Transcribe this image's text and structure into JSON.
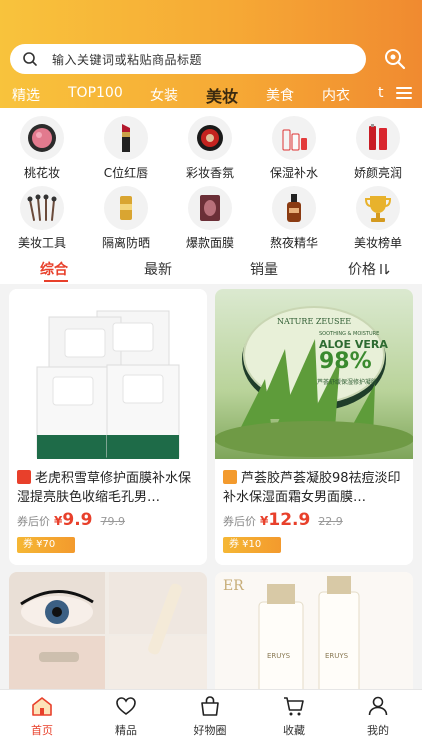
{
  "search": {
    "placeholder": "输入关键词或粘贴商品标题"
  },
  "tabs": [
    {
      "label": "精选"
    },
    {
      "label": "TOP100"
    },
    {
      "label": "女装"
    },
    {
      "label": "美妆",
      "active": true
    },
    {
      "label": "美食"
    },
    {
      "label": "内衣"
    },
    {
      "label": "t"
    }
  ],
  "categories": [
    {
      "label": "桃花妆",
      "icon": "blush-compact-icon"
    },
    {
      "label": "C位红唇",
      "icon": "lipstick-icon"
    },
    {
      "label": "彩妆香氛",
      "icon": "makeup-compact-icon"
    },
    {
      "label": "保湿补水",
      "icon": "skincare-bottles-icon"
    },
    {
      "label": "娇颜亮润",
      "icon": "red-serum-bottles-icon"
    },
    {
      "label": "美妆工具",
      "icon": "makeup-brushes-icon"
    },
    {
      "label": "隔离防晒",
      "icon": "sunscreen-icon"
    },
    {
      "label": "爆款面膜",
      "icon": "face-mask-icon"
    },
    {
      "label": "熬夜精华",
      "icon": "essence-bottle-icon"
    },
    {
      "label": "美妆榜单",
      "icon": "trophy-icon"
    }
  ],
  "sort": [
    {
      "label": "综合",
      "active": true
    },
    {
      "label": "最新"
    },
    {
      "label": "销量"
    },
    {
      "label": "价格"
    }
  ],
  "products": [
    {
      "title": "老虎积雪草修护面膜补水保湿提亮肤色收缩毛孔男…",
      "after_label": "券后价",
      "currency": "¥",
      "price": "9.9",
      "original_price": "79.9",
      "coupon": "券 ¥70",
      "badge_color": "#e8402b"
    },
    {
      "title": "芦荟胶芦荟凝胶98祛痘淡印补水保湿面霜女男面膜…",
      "after_label": "券后价",
      "currency": "¥",
      "price": "12.9",
      "original_price": "22.9",
      "coupon": "券 ¥10",
      "badge_color": "#f39a2d"
    }
  ],
  "image_text": {
    "aloe_brand": "NATURE ZEUSEE",
    "aloe_sub": "SOOTHING & MOISTURE",
    "aloe_name": "ALOE VERA",
    "aloe_percent": "98%",
    "aloe_cn": "芦荟舒缓保湿修护凝胶",
    "bottle_brand": "ERUYS",
    "logo": "ER"
  },
  "bottom_nav": [
    {
      "label": "首页",
      "icon": "home-icon",
      "active": true
    },
    {
      "label": "精品",
      "icon": "heart-icon"
    },
    {
      "label": "好物圈",
      "icon": "shopping-bag-icon"
    },
    {
      "label": "收藏",
      "icon": "cart-icon"
    },
    {
      "label": "我的",
      "icon": "user-icon"
    }
  ],
  "colors": {
    "accent": "#e8402b",
    "header_start": "#f8c33c",
    "header_end": "#f08a30"
  }
}
